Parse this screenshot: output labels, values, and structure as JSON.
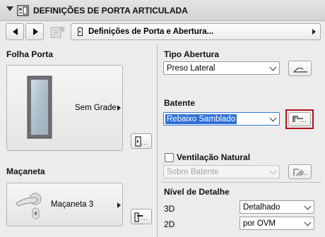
{
  "header": {
    "title": "DEFINIÇÕES DE PORTA ARTICULADA"
  },
  "navbar": {
    "field_label": "Definições de Porta e Abertura..."
  },
  "folha_porta": {
    "title": "Folha Porta",
    "preview_label": "Sem Grade",
    "settings_dots": "..."
  },
  "macaneta": {
    "title": "Maçaneta",
    "preview_label": "Maçaneta 3",
    "settings_dots": "..."
  },
  "tipo_abertura": {
    "title": "Tipo Abertura",
    "value": "Preso Lateral",
    "settings_dots": "..."
  },
  "batente": {
    "title": "Batente",
    "value": "Rebaixo Samblado",
    "settings_dots": "..."
  },
  "ventilacao": {
    "label": "Ventilação Natural",
    "checked": false,
    "value": "Sobre Batente",
    "settings_dots": "..."
  },
  "nivel_detalhe": {
    "title": "Nível de Detalhe",
    "rows": [
      {
        "label": "3D",
        "value": "Detalhado"
      },
      {
        "label": "2D",
        "value": "por OVM"
      }
    ]
  },
  "colors": {
    "highlight": "#b31217",
    "selection": "#2f6fd6"
  }
}
